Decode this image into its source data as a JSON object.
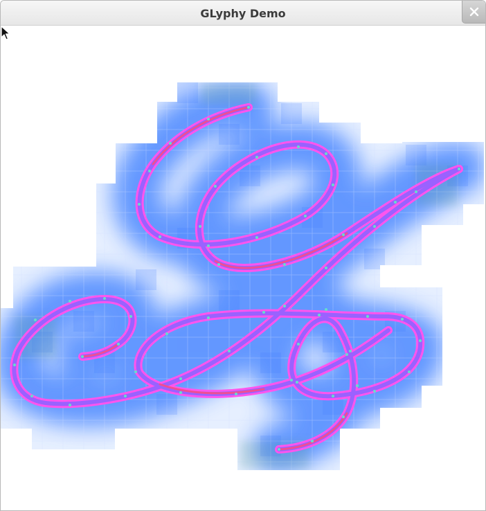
{
  "window": {
    "title": "GLyphy Demo"
  },
  "colors": {
    "titlebar": "#ececec",
    "glow": "#7fb2ff",
    "stroke_outer": "#ff55ee",
    "stroke_inner": "#8866ff",
    "glyph_fill": "#ff4a80",
    "points": "#66ddcc"
  },
  "icons": {
    "close": "close-icon",
    "cursor": "mouse-pointer-icon"
  }
}
